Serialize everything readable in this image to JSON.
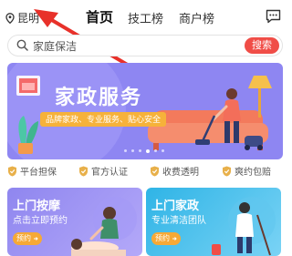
{
  "header": {
    "location_label": "昆明",
    "tabs": [
      {
        "label": "首页",
        "active": true
      },
      {
        "label": "技工榜",
        "active": false
      },
      {
        "label": "商户榜",
        "active": false
      }
    ]
  },
  "search": {
    "value": "家庭保洁",
    "button_label": "搜索"
  },
  "banner": {
    "title": "家政服务",
    "subtitle": "品牌家政、专业服务、贴心安全",
    "slide_count": 6,
    "active_slide": 4
  },
  "features": [
    {
      "label": "平台担保",
      "icon": "shield-check-icon"
    },
    {
      "label": "官方认证",
      "icon": "shield-check-icon"
    },
    {
      "label": "收费透明",
      "icon": "shield-check-icon"
    },
    {
      "label": "爽约包赔",
      "icon": "shield-check-icon"
    }
  ],
  "cards": [
    {
      "title": "上门按摩",
      "subtitle": "点击立即预约",
      "button": "预约"
    },
    {
      "title": "上门家政",
      "subtitle": "专业清洁团队",
      "button": "预约"
    }
  ],
  "colors": {
    "accent": "#f04d47",
    "banner": "#8e86f2",
    "badge": "#f6b23a",
    "feature_icon": "#e8b04a"
  }
}
